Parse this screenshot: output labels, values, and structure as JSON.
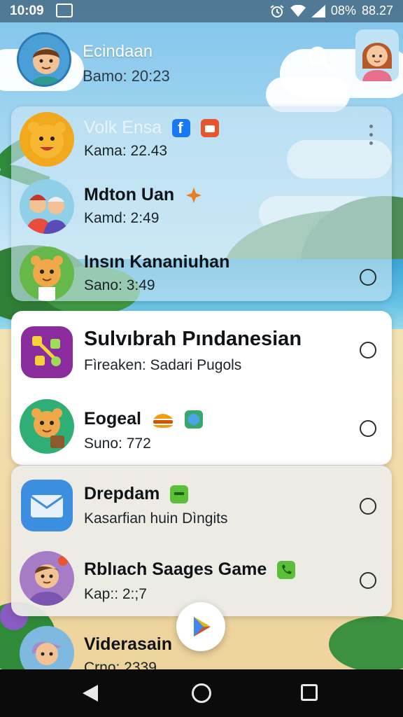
{
  "status_bar": {
    "time": "10:09",
    "battery": "08%",
    "clock_right": "88.27",
    "icons": [
      "notification-icon",
      "alarm-icon",
      "wifi-icon",
      "signal-icon"
    ]
  },
  "header": {
    "name": "Ecindaan",
    "subtitle": "Bamo: 20:23",
    "search_icon": "search-icon"
  },
  "cards": {
    "top": [
      {
        "title": "Volk Ensa",
        "subtitle": "Kama: 22.43",
        "badges": [
          "facebook-icon",
          "bag-icon"
        ],
        "has_more": true
      },
      {
        "title": "Mdton Uan",
        "subtitle": "Kamd: 2:49",
        "badges": [
          "sparkle-icon"
        ]
      },
      {
        "title": "Insın Kananiuhan",
        "subtitle": "Sano: 3:49",
        "radio": true
      }
    ],
    "middle": [
      {
        "title": "Sulvıbrah Pındanesian",
        "subtitle": "Fìreaken: Sadari Pugols",
        "radio": true
      },
      {
        "title": "Eogeal",
        "subtitle": "Suno: 772",
        "badges": [
          "burger-icon",
          "cube-icon"
        ],
        "radio": true
      }
    ],
    "bottom": [
      {
        "title": "Drepdam",
        "subtitle": "Kasarfian huin Dìngits",
        "badges": [
          "chat-icon"
        ],
        "radio": true
      },
      {
        "title": "Rblıach Saages Game",
        "subtitle": "Kap:: 2:;7",
        "badges": [
          "phone-icon"
        ],
        "radio": true
      }
    ]
  },
  "partial_row": {
    "title": "Viderasain",
    "subtitle": "Crno: 2339"
  },
  "colors": {
    "accent_blue": "#2c78b5",
    "facebook": "#1877f2",
    "play_triangle": "#34a853",
    "radio_border": "#2a2e33"
  },
  "navbar": {
    "buttons": [
      "back-icon",
      "home-icon",
      "recents-icon"
    ]
  }
}
